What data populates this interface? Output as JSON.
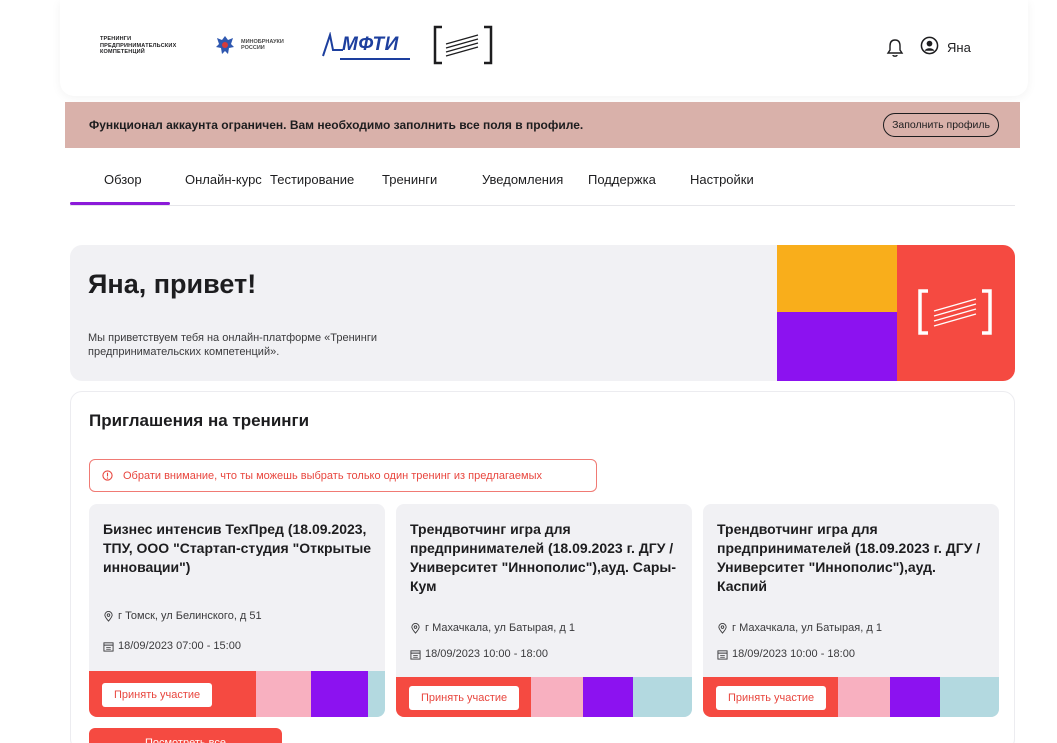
{
  "header": {
    "logo_tpk": "ТРЕНИНГИ ПРЕДПРИНИМАТЕЛЬСКИХ КОМПЕТЕНЦИЙ",
    "logo_minobr": "МИНОБРНАУКИ РОССИИ",
    "logo_mipt": "МФТИ",
    "user_name": "Яна"
  },
  "banner": {
    "text": "Функционал аккаунта ограничен. Вам необходимо заполнить все поля в профиле.",
    "button": "Заполнить профиль"
  },
  "tabs": [
    {
      "label": "Обзор",
      "active": true
    },
    {
      "label": "Онлайн-курс",
      "active": false
    },
    {
      "label": "Тестирование",
      "active": false
    },
    {
      "label": "Тренинги",
      "active": false
    },
    {
      "label": "Уведомления",
      "active": false
    },
    {
      "label": "Поддержка",
      "active": false
    },
    {
      "label": "Настройки",
      "active": false
    }
  ],
  "welcome": {
    "title": "Яна, привет!",
    "subtitle": "Мы приветствуем тебя на онлайн-платформе «Тренинги предпринимательских компетенций»."
  },
  "invites": {
    "title": "Приглашения на тренинги",
    "notice": "Обрати внимание, что ты можешь выбрать только один тренинг из предлагаемых",
    "cards": [
      {
        "title": "Бизнес интенсив ТехПред (18.09.2023, ТПУ, ООО \"Стартап-студия \"Открытые инновации\")",
        "location": "г Томск, ул Белинского, д 51",
        "datetime": "18/09/2023 07:00 - 15:00",
        "button": "Принять участие"
      },
      {
        "title": "Трендвотчинг игра для предпринимателей (18.09.2023 г. ДГУ / Университет \"Иннополис\"),ауд. Сары-Кум",
        "location": "г Махачкала, ул Батырая, д 1",
        "datetime": "18/09/2023 10:00 - 18:00",
        "button": "Принять участие"
      },
      {
        "title": "Трендвотчинг игра для предпринимателей (18.09.2023 г. ДГУ / Университет \"Иннополис\"),ауд. Каспий",
        "location": "г Махачкала, ул Батырая, д 1",
        "datetime": "18/09/2023 10:00 - 18:00",
        "button": "Принять участие"
      }
    ],
    "view_all": "Посмотреть все"
  },
  "colors": {
    "accent_purple": "#8b1ad9",
    "brand_red": "#f54a41",
    "brand_yellow": "#f9ae1b",
    "brand_violet": "#8c12f0",
    "banner_bg": "#d9b1aa"
  }
}
